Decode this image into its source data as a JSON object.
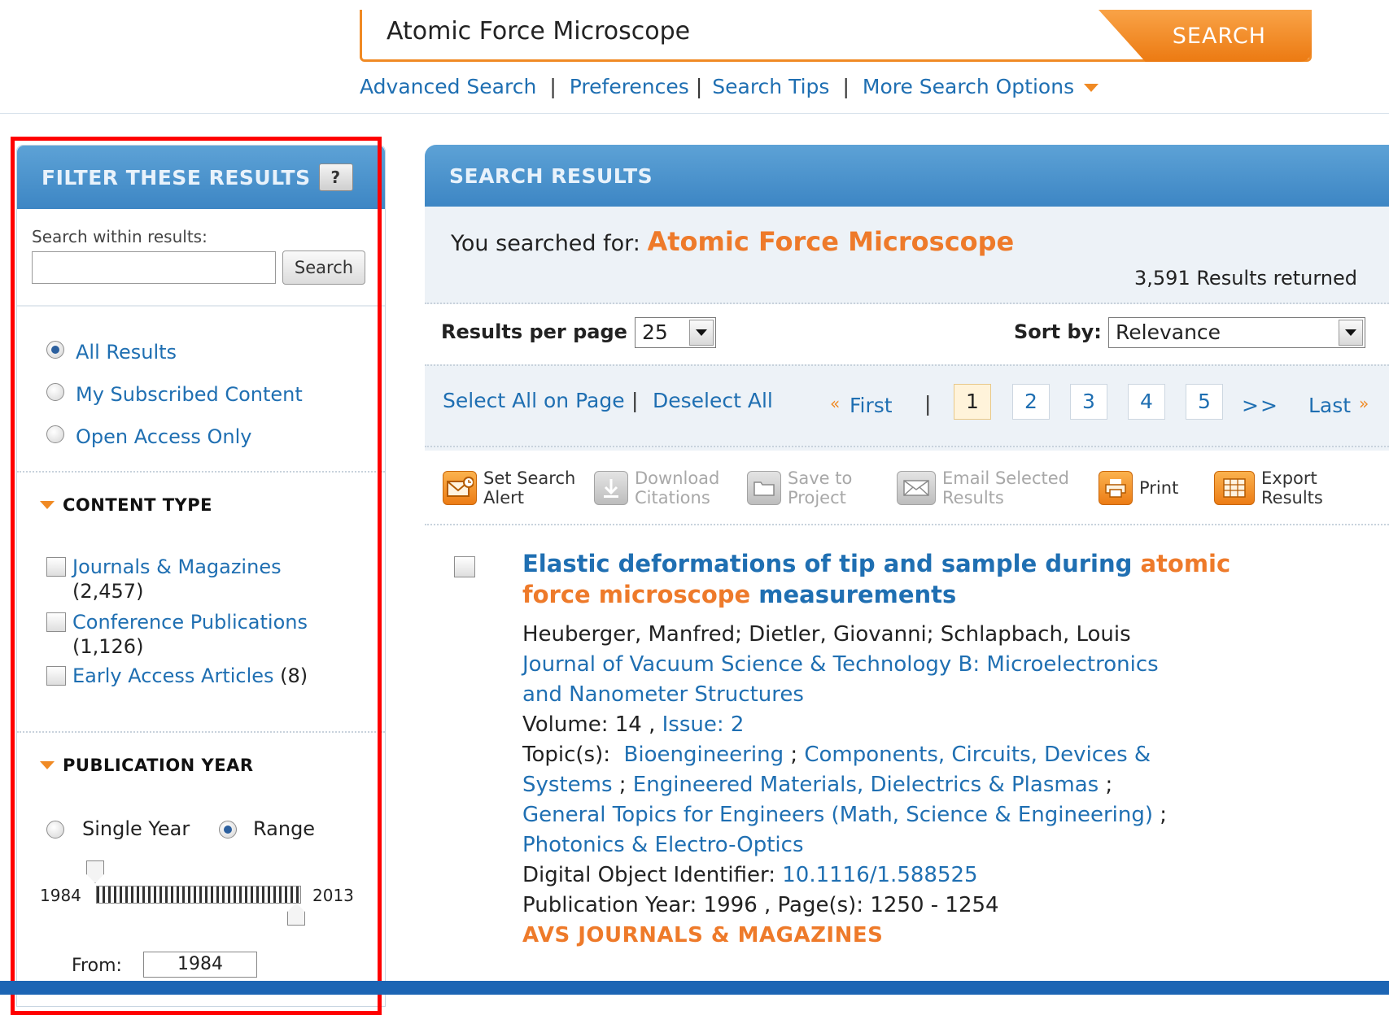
{
  "search": {
    "query": "Atomic Force Microscope",
    "button_label": "SEARCH",
    "links": [
      "Advanced Search",
      "Preferences",
      "Search Tips",
      "More Search Options"
    ]
  },
  "filter": {
    "header": "FILTER THESE RESULTS",
    "help_label": "?",
    "within_label": "Search within results:",
    "within_value": "",
    "within_button": "Search",
    "access_options": [
      {
        "label": "All Results",
        "checked": true
      },
      {
        "label": "My Subscribed Content",
        "checked": false
      },
      {
        "label": "Open Access Only",
        "checked": false
      }
    ],
    "content_type": {
      "title": "CONTENT TYPE",
      "items": [
        {
          "label": "Journals & Magazines",
          "count": "(2,457)"
        },
        {
          "label": "Conference Publications",
          "count": "(1,126)"
        },
        {
          "label": "Early Access Articles",
          "count": "(8)"
        }
      ]
    },
    "publication_year": {
      "title": "PUBLICATION YEAR",
      "mode_single": "Single Year",
      "mode_range": "Range",
      "selected_mode": "Range",
      "min_year": "1984",
      "max_year": "2013",
      "from_label": "From:",
      "from_value": "1984"
    }
  },
  "results": {
    "header": "SEARCH RESULTS",
    "searched_for_label": "You searched for:",
    "searched_term": "Atomic Force Microscope",
    "count_text": "3,591 Results returned",
    "per_page_label": "Results per page",
    "per_page_value": "25",
    "sort_label": "Sort by:",
    "sort_value": "Relevance",
    "select_all": "Select All on Page",
    "deselect_all": "Deselect All",
    "pager": {
      "first": "First",
      "first_prefix": "«",
      "separator": "|",
      "pages": [
        "1",
        "2",
        "3",
        "4",
        "5"
      ],
      "current_page": "1",
      "next": ">>",
      "last": "Last",
      "last_suffix": "»"
    },
    "tools": [
      {
        "line1": "Set Search",
        "line2": "Alert",
        "enabled": true,
        "icon": "mail-clock-icon"
      },
      {
        "line1": "Download",
        "line2": "Citations",
        "enabled": false,
        "icon": "download-icon"
      },
      {
        "line1": "Save to",
        "line2": "Project",
        "enabled": false,
        "icon": "folder-icon"
      },
      {
        "line1": "Email Selected",
        "line2": "Results",
        "enabled": false,
        "icon": "email-icon"
      },
      {
        "line1": "Print",
        "line2": "",
        "enabled": true,
        "icon": "print-icon"
      },
      {
        "line1": "Export",
        "line2": "Results",
        "enabled": true,
        "icon": "export-icon"
      }
    ],
    "first_result": {
      "title_part1": "Elastic deformations of tip and sample during ",
      "title_hl1": "atomic",
      "title_hl2": "force microscope",
      "title_part2": " measurements",
      "authors": "Heuberger, Manfred; Dietler, Giovanni; Schlapbach, Louis",
      "journal_line1": "Journal of Vacuum Science & Technology B: Microelectronics",
      "journal_line2": "and Nanometer Structures",
      "volume_label": "Volume: 14 ,",
      "issue": "Issue: 2",
      "topics_label": "Topic(s):",
      "topic1": "Bioengineering",
      "topic2a": "Components, Circuits, Devices &",
      "topic2b": "Systems",
      "topic3": "Engineered Materials, Dielectrics & Plasmas",
      "topic4": "General Topics for Engineers (Math, Science & Engineering)",
      "topic5": "Photonics & Electro-Optics",
      "topic_sep": ";",
      "doi_label": "Digital Object Identifier:",
      "doi": "10.1116/1.588525",
      "pub_year_pages": "Publication Year: 1996 , Page(s): 1250 - 1254",
      "publisher": "AVS JOURNALS & MAGAZINES"
    }
  },
  "colors": {
    "accent_orange": "#f08a24",
    "header_blue": "#3d86c4",
    "link_blue": "#1f6fb2",
    "highlight_red": "#ff0000",
    "bottom_bar": "#1c65b4"
  }
}
